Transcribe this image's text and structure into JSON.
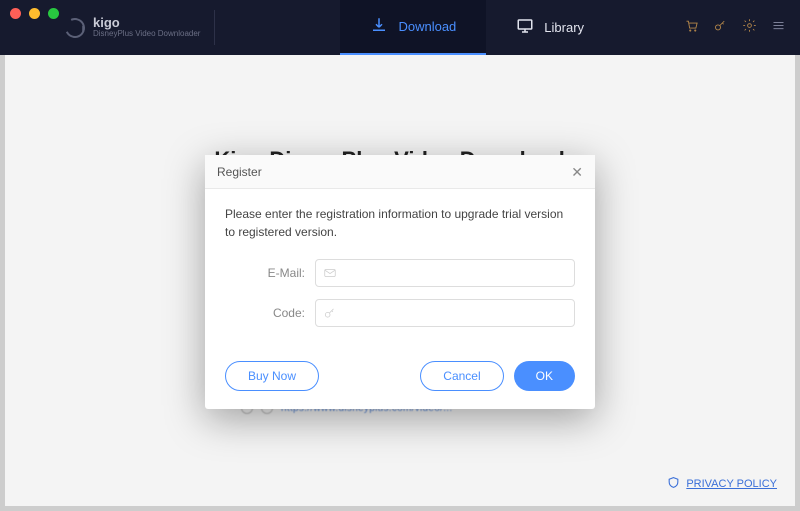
{
  "brand": {
    "name": "kigo",
    "subtitle": "DisneyPlus Video Downloader"
  },
  "tabs": {
    "download": "Download",
    "library": "Library"
  },
  "hero_title": "Kigo DisneyPlus Video Downloader",
  "modal": {
    "title": "Register",
    "instructions": "Please enter the registration information to upgrade trial version to registered version.",
    "email_label": "E-Mail:",
    "code_label": "Code:",
    "buy_now": "Buy Now",
    "cancel": "Cancel",
    "ok": "OK",
    "close_glyph": "✕"
  },
  "footer": {
    "privacy": "PRIVACY POLICY"
  },
  "url_ghost": "https://www.disneyplus.com/video/..."
}
